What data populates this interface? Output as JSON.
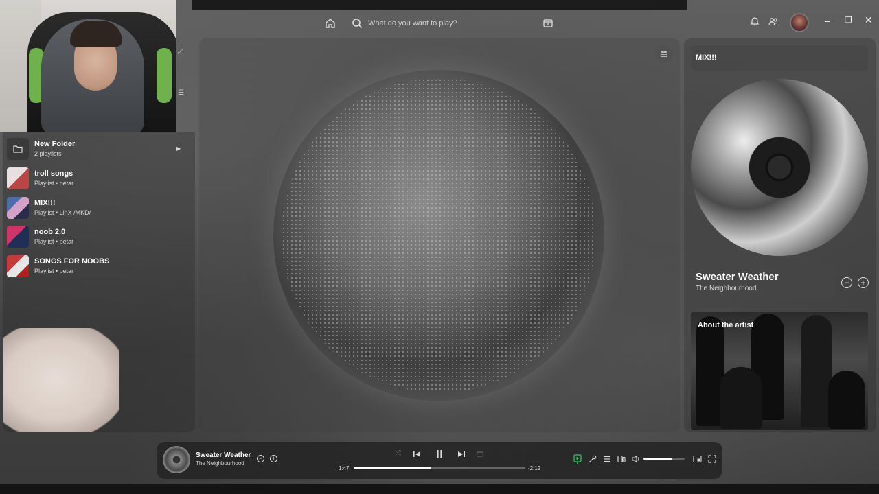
{
  "search": {
    "placeholder": "What do you want to play?"
  },
  "library": {
    "items": [
      {
        "title": "New Folder",
        "subtitle": "2 playlists",
        "type": "folder"
      },
      {
        "title": "troll songs",
        "subtitle": "Playlist • petar",
        "type": "playlist"
      },
      {
        "title": "MIX!!!",
        "subtitle": "Playlist • LinX /MKD/",
        "type": "playlist"
      },
      {
        "title": "noob 2.0",
        "subtitle": "Playlist • petar",
        "type": "playlist"
      },
      {
        "title": "SONGS FOR NOOBS",
        "subtitle": "Playlist • petar",
        "type": "playlist"
      }
    ]
  },
  "right_panel": {
    "playlist_title": "MIX!!!",
    "track_title": "Sweater Weather",
    "track_artist": "The Neighbourhood",
    "about_label": "About the artist"
  },
  "player": {
    "title": "Sweater Weather",
    "artist": "The Neighbourhood",
    "elapsed": "1:47",
    "remaining": "-2:12",
    "progress_fraction": 0.45,
    "volume_fraction": 0.7,
    "accent_color": "#1ed760"
  },
  "window": {
    "min": "–",
    "max": "❐",
    "close": "✕"
  }
}
